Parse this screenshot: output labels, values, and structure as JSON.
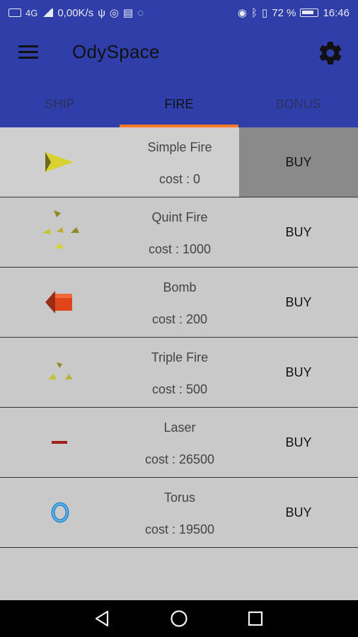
{
  "status_bar": {
    "network_speed": "0,00K/s",
    "signal_label": "4G",
    "battery_percent": "72 %",
    "time": "16:46"
  },
  "app_bar": {
    "title": "OdySpace",
    "menu_icon": "hamburger-icon",
    "settings_icon": "gear-icon"
  },
  "tabs": [
    {
      "label": "SHIP",
      "active": false
    },
    {
      "label": "FIRE",
      "active": true
    },
    {
      "label": "BONUS",
      "active": false
    }
  ],
  "items": [
    {
      "name": "Simple Fire",
      "cost": "cost : 0",
      "button": "BUY",
      "icon": "yellow-pyramid-icon",
      "selected": true
    },
    {
      "name": "Quint Fire",
      "cost": "cost : 1000",
      "button": "BUY",
      "icon": "five-pyramids-icon",
      "selected": false
    },
    {
      "name": "Bomb",
      "cost": "cost : 200",
      "button": "BUY",
      "icon": "red-arrow-bomb-icon",
      "selected": false
    },
    {
      "name": "Triple Fire",
      "cost": "cost : 500",
      "button": "BUY",
      "icon": "three-pyramids-icon",
      "selected": false
    },
    {
      "name": "Laser",
      "cost": "cost : 26500",
      "button": "BUY",
      "icon": "red-laser-icon",
      "selected": false
    },
    {
      "name": "Torus",
      "cost": "cost : 19500",
      "button": "BUY",
      "icon": "blue-torus-icon",
      "selected": false
    }
  ],
  "nav_bar": {
    "back_icon": "back-triangle-icon",
    "home_icon": "home-circle-icon",
    "recents_icon": "recents-square-icon"
  },
  "colors": {
    "primary": "#2f3ea8",
    "accent": "#ff7b26",
    "list_background": "#c9c9c9",
    "selected_buy": "#8a8a8a"
  }
}
